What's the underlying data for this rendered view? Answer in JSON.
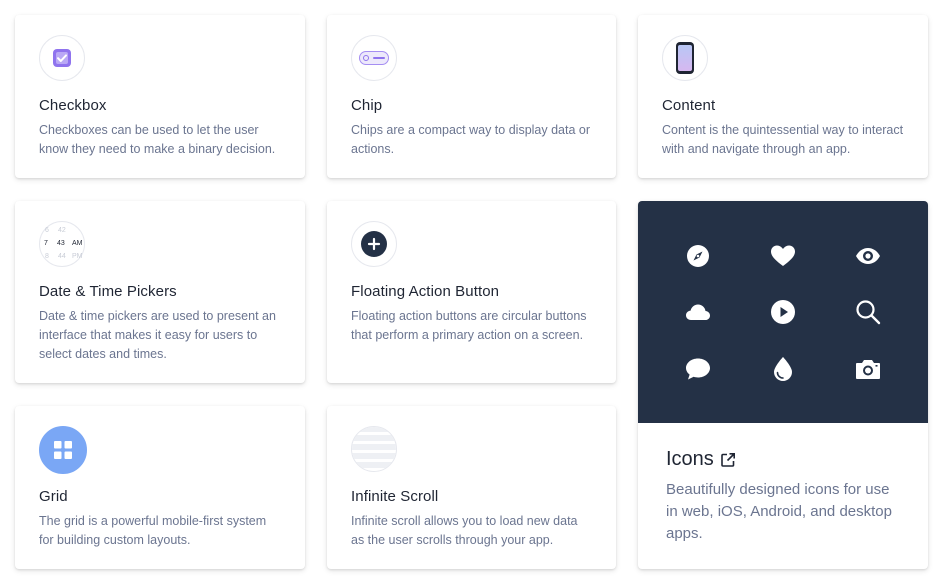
{
  "cards": [
    {
      "title": "Checkbox",
      "description": "Checkboxes can be used to let the user know they need to make a binary decision.",
      "icon": "checkbox-icon"
    },
    {
      "title": "Chip",
      "description": "Chips are a compact way to display data or actions.",
      "icon": "chip-icon"
    },
    {
      "title": "Content",
      "description": "Content is the quintessential way to interact with and navigate through an app.",
      "icon": "phone-icon"
    },
    {
      "title": "Date & Time Pickers",
      "description": "Date & time pickers are used to present an interface that makes it easy for users to select dates and times.",
      "icon": "date-picker-icon"
    },
    {
      "title": "Floating Action Button",
      "description": "Floating action buttons are circular buttons that perform a primary action on a screen.",
      "icon": "fab-plus-icon"
    },
    {
      "title": "Grid",
      "description": "The grid is a powerful mobile-first system for building custom layouts.",
      "icon": "grid-icon"
    },
    {
      "title": "Infinite Scroll",
      "description": "Infinite scroll allows you to load new data as the user scrolls through your app.",
      "icon": "infinite-scroll-icon"
    }
  ],
  "date_picker_icon": {
    "rows": [
      {
        "c1": "6",
        "c2": "42",
        "c3": ""
      },
      {
        "c1": "7",
        "c2": "43",
        "c3": "AM"
      },
      {
        "c1": "8",
        "c2": "44",
        "c3": "PM"
      }
    ]
  },
  "icons_card": {
    "title": "Icons",
    "description": "Beautifully designed icons for use in web, iOS, Android, and desktop apps.",
    "hero_background": "#243146",
    "grid_icons": [
      "compass-icon",
      "heart-icon",
      "eye-icon",
      "cloud-icon",
      "play-icon",
      "search-icon",
      "chat-bubble-icon",
      "water-drop-icon",
      "camera-icon"
    ]
  },
  "colors": {
    "accent_purple": "#8f73ee",
    "grid_blue": "#7aa7f5",
    "fab_dark": "#243146",
    "text_dark": "#1f2533",
    "text_muted": "#6b7590"
  }
}
